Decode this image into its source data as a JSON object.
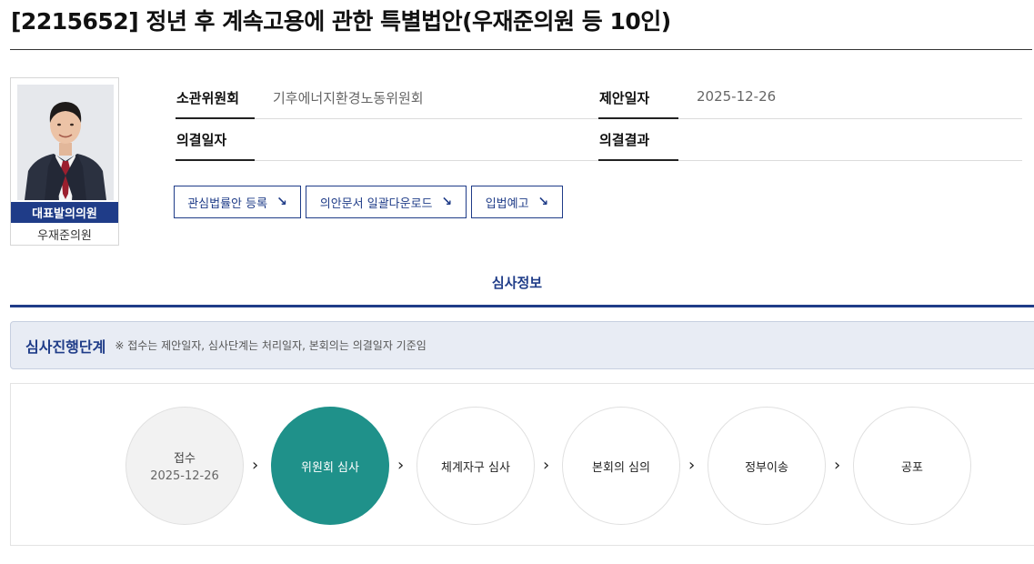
{
  "title": "[2215652] 정년 후 계속고용에 관한 특별법안(우재준의원 등 10인)",
  "sponsor": {
    "role": "대표발의의원",
    "name": "우재준의원"
  },
  "info": {
    "committee_label": "소관위원회",
    "committee_value": "기후에너지환경노동위원회",
    "proposal_date_label": "제안일자",
    "proposal_date_value": "2025-12-26",
    "resolution_date_label": "의결일자",
    "resolution_date_value": "",
    "resolution_result_label": "의결결과",
    "resolution_result_value": ""
  },
  "buttons": {
    "watch": "관심법률안 등록",
    "download": "의안문서 일괄다운로드",
    "prenotice": "입법예고",
    "arrow_icon": "↘"
  },
  "tab": {
    "label": "심사정보"
  },
  "stage": {
    "heading": "심사진행단계",
    "note": "※ 접수는 제안일자, 심사단계는 처리일자, 본회의는 의결일자 기준임"
  },
  "steps": [
    {
      "label": "접수",
      "date": "2025-12-26",
      "state": "done"
    },
    {
      "label": "위원회 심사",
      "date": "",
      "state": "active"
    },
    {
      "label": "체계자구 심사",
      "date": "",
      "state": "pending"
    },
    {
      "label": "본회의 심의",
      "date": "",
      "state": "pending"
    },
    {
      "label": "정부이송",
      "date": "",
      "state": "pending"
    },
    {
      "label": "공포",
      "date": "",
      "state": "pending"
    }
  ],
  "chevron_icon": "›",
  "colors": {
    "navy": "#1f3c88",
    "active_step": "#1f918a",
    "done_step": "#f2f2f2"
  }
}
